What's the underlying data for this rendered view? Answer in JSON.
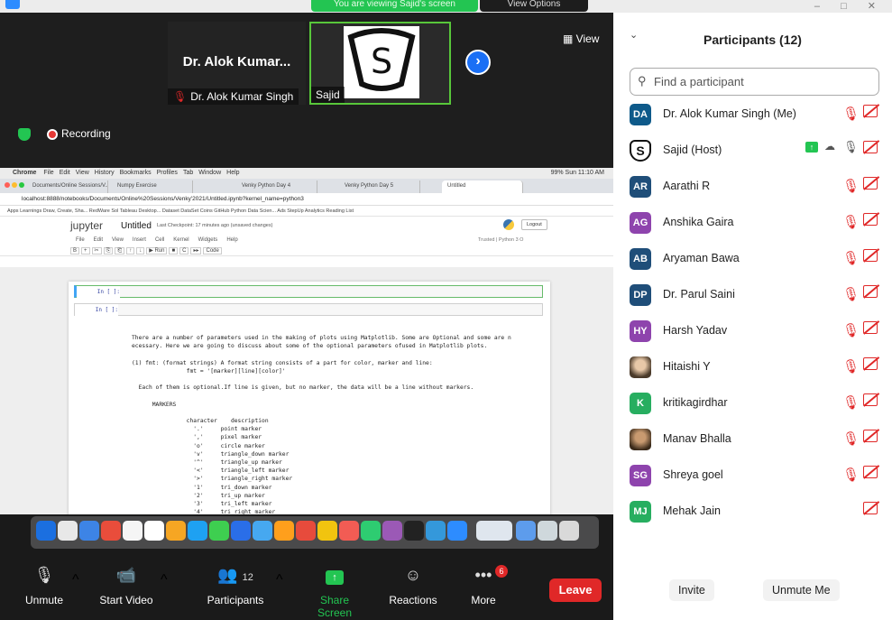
{
  "topbar": {
    "banner": "You are viewing Sajid's screen",
    "banner2": "View Options",
    "win_controls": "– □ ✕"
  },
  "tiles": [
    {
      "name_big": "Dr. Alok Kumar...",
      "name_small": "Dr. Alok Kumar Singh"
    },
    {
      "name": "Sajid",
      "logo_letter": "S"
    }
  ],
  "view_label": "View",
  "recording_label": "Recording",
  "shared": {
    "mac_menu": [
      "Chrome",
      "File",
      "Edit",
      "View",
      "History",
      "Bookmarks",
      "Profiles",
      "Tab",
      "Window",
      "Help"
    ],
    "mac_status": "99% Sun 11:10 AM",
    "tabs": [
      "Documents/Online Sessions/V...",
      "Numpy Exercise",
      "Venky Python Day 4",
      "Venky Python Day 5",
      "Untitled"
    ],
    "url": "localhost:8888/notebooks/Documents/Online%20Sessions/Venky'2021/Untitled.ipynb?kernel_name=python3",
    "bookmarks": "Apps  Learnings  Draw, Create, Sha...  RedWare Sol  Tableau Desktop...  Dataset  DataSet  Coins  GitHub  Python Data Scien...  Ads  StepUp Analytics    Reading List",
    "jupyter_logo": "jupyter",
    "notebook_title": "Untitled",
    "checkpoint": "Last Checkpoint: 17 minutes ago  (unsaved changes)",
    "logout": "Logout",
    "menu": [
      "File",
      "Edit",
      "View",
      "Insert",
      "Cell",
      "Kernel",
      "Widgets",
      "Help"
    ],
    "trusted": "Trusted  |  Python 3  O",
    "toolbar": [
      "B",
      "+",
      "✂",
      "⎘",
      "⎗",
      "↑",
      "↓",
      "▶ Run",
      "■",
      "C",
      "▸▸",
      "Code"
    ],
    "prompt1": "In [ ]:",
    "prompt2": "In [ ]:",
    "notebook_text": "There are a number of parameters used in the making of plots using Matplotlib. Some are Optional and some are n\necessary. Here we are going to discuss about some of the optional parameters ofused in Matplotlib plots.\n\n(1) fmt: (format strings) A format string consists of a part for color, marker and line:\n                fmt = '[marker][line][color]'\n\n  Each of them is optional.If line is given, but no marker, the data will be a line without markers.\n\n      MARKERS\n\n                character    description\n                  '.'     point marker\n                  ','     pixel marker\n                  'o'     circle marker\n                  'v'     triangle_down marker\n                  '^'     triangle_up marker\n                  '<'     triangle_left marker\n                  '>'     triangle_right marker\n                  '1'     tri_down marker\n                  '2'     tri_up marker\n                  '3'     tri_left marker\n                  '4'     tri_right marker"
  },
  "toolbar": {
    "unmute": "Unmute",
    "start_video": "Start Video",
    "participants": "Participants",
    "participants_count": "12",
    "share_screen": "Share Screen",
    "reactions": "Reactions",
    "more": "More",
    "more_badge": "6",
    "leave": "Leave"
  },
  "panel": {
    "title": "Participants (12)",
    "search_placeholder": "Find a participant",
    "participants": [
      {
        "initials": "DA",
        "name": "Dr. Alok Kumar Singh (Me)",
        "color": "#0e5a8a"
      },
      {
        "initials": "S",
        "name": "Sajid (Host)",
        "color": "#ffffff"
      },
      {
        "initials": "AR",
        "name": "Aarathi R",
        "color": "#1f4e79"
      },
      {
        "initials": "AG",
        "name": "Anshika Gaira",
        "color": "#8e44ad"
      },
      {
        "initials": "AB",
        "name": "Aryaman Bawa",
        "color": "#1f4e79"
      },
      {
        "initials": "DP",
        "name": "Dr. Parul Saini",
        "color": "#1f4e79"
      },
      {
        "initials": "HY",
        "name": "Harsh Yadav",
        "color": "#8e44ad"
      },
      {
        "initials": "",
        "name": "Hitaishi Y",
        "color": "#7a6a55"
      },
      {
        "initials": "K",
        "name": "kritikagirdhar",
        "color": "#27ae60"
      },
      {
        "initials": "",
        "name": "Manav Bhalla",
        "color": "#8a5a3a"
      },
      {
        "initials": "SG",
        "name": "Shreya goel",
        "color": "#8e44ad"
      },
      {
        "initials": "MJ",
        "name": "Mehak Jain",
        "color": "#27ae60"
      }
    ],
    "invite": "Invite",
    "unmute_me": "Unmute Me"
  }
}
